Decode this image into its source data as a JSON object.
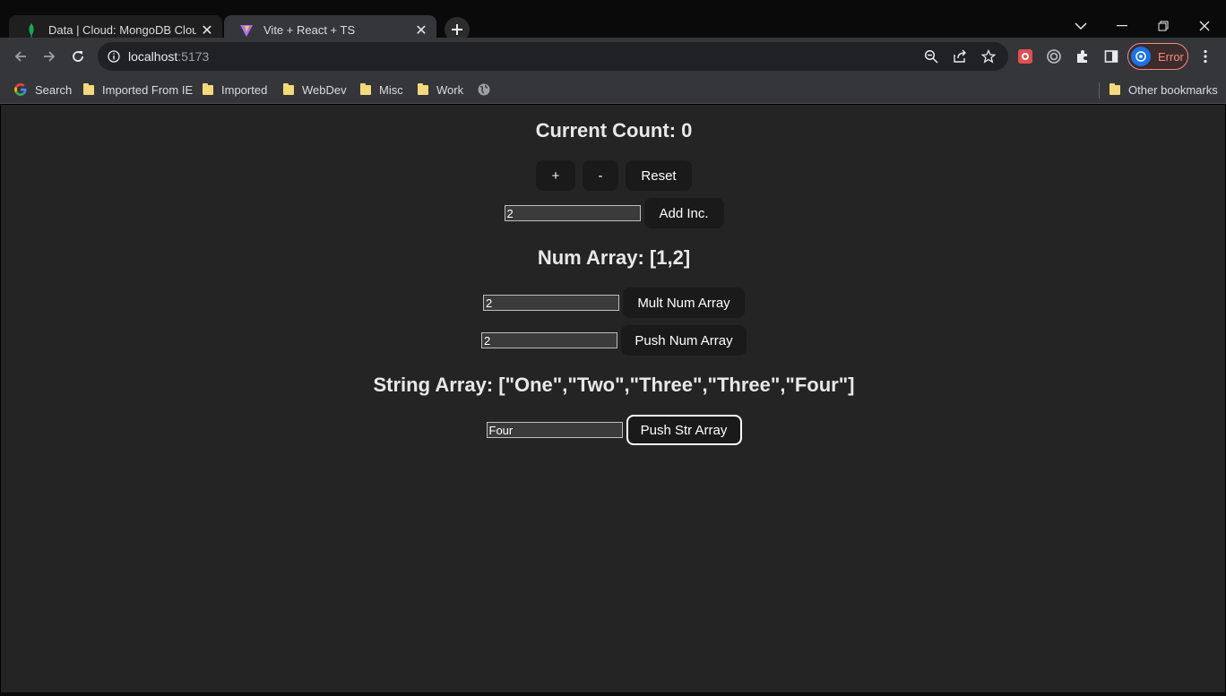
{
  "browser": {
    "tabs": [
      {
        "title": "Data | Cloud: MongoDB Cloud",
        "active": false
      },
      {
        "title": "Vite + React + TS",
        "active": true
      }
    ],
    "address": {
      "host": "localhost",
      "port": ":5173"
    },
    "profile_label": "Error",
    "bookmarks": [
      {
        "label": "Search",
        "icon": "google-icon"
      },
      {
        "label": "Imported From IE",
        "icon": "folder-icon"
      },
      {
        "label": "Imported",
        "icon": "folder-icon"
      },
      {
        "label": "WebDev",
        "icon": "folder-icon"
      },
      {
        "label": "Misc",
        "icon": "folder-icon"
      },
      {
        "label": "Work",
        "icon": "folder-icon"
      },
      {
        "label": "",
        "icon": "globe-icon"
      }
    ],
    "other_bookmarks": "Other bookmarks"
  },
  "app": {
    "count_heading": "Current Count: 0",
    "buttons": {
      "increment": "+",
      "decrement": "-",
      "reset": "Reset",
      "add_inc": "Add Inc.",
      "mult_num": "Mult Num Array",
      "push_num": "Push Num Array",
      "push_str": "Push Str Array"
    },
    "inputs": {
      "increment_value": "2",
      "mult_value": "2",
      "push_num_value": "2",
      "push_str_value": "Four"
    },
    "num_array_heading": "Num Array: [1,2]",
    "string_array_heading": "String Array: [\"One\",\"Two\",\"Three\",\"Three\",\"Four\"]"
  },
  "colors": {
    "page_bg": "#242424",
    "button_bg": "#1a1a1a",
    "error_accent": "#f28b82"
  }
}
